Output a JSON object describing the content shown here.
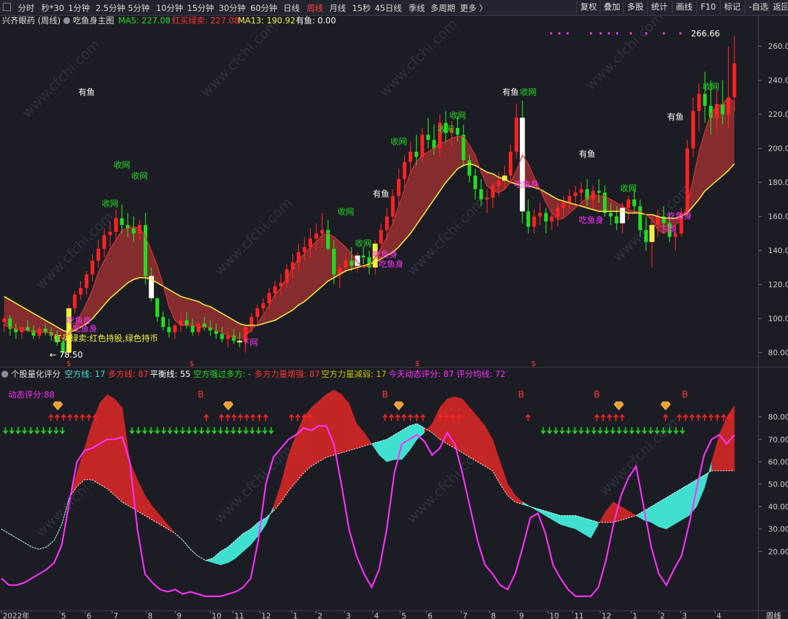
{
  "toolbar": {
    "left_items": [
      "分时",
      "秒*30",
      "1分钟",
      "2.5分钟",
      "5分钟",
      "10分钟",
      "15分钟",
      "30分钟",
      "60分钟",
      "日线",
      "周线",
      "月线",
      "15秒",
      "45日线",
      "季线",
      "多周期",
      "更多 〉"
    ],
    "active": "周线",
    "right_items": [
      "复权",
      "叠加",
      "多股",
      "统计",
      "画线",
      "F10",
      "标记",
      "-自选",
      "返回"
    ]
  },
  "colors": {
    "bg": "#1c1d24",
    "up": "#ff2222",
    "down": "#22dd22",
    "ma_yellow": "#f0f040",
    "magenta": "#ff30ff",
    "cyan": "#40e0d0",
    "band_red": "#a83232",
    "white": "#ffffff"
  },
  "main_header": {
    "stock": "兴齐眼药 (周线)",
    "indicator": "吃鱼身主图",
    "items": [
      {
        "label": "MA5: 227.08",
        "color": "#22dd22"
      },
      {
        "label": "红买绿卖: 227.08",
        "color": "#ff3333"
      },
      {
        "label": "MA13: 190.92",
        "color": "#f0f040"
      },
      {
        "label": "有鱼: 0.00",
        "color": "#ffffff"
      }
    ]
  },
  "sub_header": {
    "title": "个股量化评分",
    "items": [
      {
        "label": "空方线: 17",
        "color": "#40e0d0"
      },
      {
        "label": "多方线: 87",
        "color": "#ff3333"
      },
      {
        "label": "平衡线: 55",
        "color": "#ffffff"
      },
      {
        "label": "空方强过多方: -",
        "color": "#22dd22"
      },
      {
        "label": "多方力量增强: 87",
        "color": "#ff3333"
      },
      {
        "label": "空方力量减弱: 17",
        "color": "#c0c000"
      },
      {
        "label": "今天动态评分: 87",
        "color": "#ff30ff"
      },
      {
        "label": "评分均线: 72",
        "color": "#ff30ff"
      }
    ],
    "dynamic_label": "动态评分:88"
  },
  "annotations": {
    "high_price": "266.66",
    "low_price": "78.50",
    "low_arrow": "←",
    "text_you_yu": "有鱼",
    "text_shou_wang": "收网",
    "text_xia_wang": "下网",
    "text_chi_yu_shen": "吃鱼身",
    "text_hold": "红买绿卖:红色持股,绿色持币",
    "text_dollar": "$",
    "text_b": "B",
    "watermark": "www.cfchi.com"
  },
  "x_axis": {
    "labels": [
      "2022年",
      "5",
      "6",
      "7",
      "8",
      "9",
      "10",
      "11",
      "12",
      "1",
      "2",
      "3",
      "4",
      "5",
      "6",
      "7",
      "8",
      "9",
      "10",
      "11",
      "12",
      "1",
      "2",
      "3",
      "4"
    ],
    "corner": "周线"
  },
  "chart_data": [
    {
      "type": "candlestick",
      "title": "吃鱼身主图",
      "y_ticks": [
        80,
        100,
        120,
        140,
        160,
        180,
        200,
        220,
        240,
        260
      ],
      "ylim": [
        73,
        271
      ],
      "ohlc": [
        [
          98,
          101,
          92,
          100
        ],
        [
          100,
          102,
          90,
          94
        ],
        [
          94,
          97,
          88,
          92
        ],
        [
          92,
          95,
          88,
          95
        ],
        [
          95,
          99,
          92,
          93
        ],
        [
          93,
          96,
          88,
          90
        ],
        [
          90,
          95,
          88,
          94
        ],
        [
          94,
          97,
          90,
          92
        ],
        [
          92,
          95,
          87,
          90
        ],
        [
          90,
          93,
          84,
          86
        ],
        [
          86,
          89,
          79,
          80
        ],
        [
          80,
          108,
          78,
          106
        ],
        [
          106,
          116,
          103,
          114
        ],
        [
          114,
          122,
          111,
          118
        ],
        [
          118,
          128,
          114,
          126
        ],
        [
          126,
          138,
          122,
          134
        ],
        [
          134,
          146,
          130,
          141
        ],
        [
          141,
          153,
          136,
          149
        ],
        [
          149,
          157,
          142,
          151
        ],
        [
          151,
          164,
          145,
          159
        ],
        [
          159,
          167,
          150,
          155
        ],
        [
          155,
          162,
          148,
          153
        ],
        [
          153,
          160,
          145,
          150
        ],
        [
          150,
          158,
          146,
          155
        ],
        [
          155,
          162,
          120,
          125
        ],
        [
          125,
          130,
          110,
          112
        ],
        [
          112,
          108,
          98,
          101
        ],
        [
          101,
          104,
          93,
          95
        ],
        [
          95,
          100,
          89,
          92
        ],
        [
          92,
          97,
          88,
          96
        ],
        [
          96,
          102,
          92,
          99
        ],
        [
          99,
          104,
          94,
          96
        ],
        [
          96,
          100,
          90,
          92
        ],
        [
          92,
          98,
          90,
          97
        ],
        [
          97,
          101,
          93,
          95
        ],
        [
          95,
          99,
          90,
          93
        ],
        [
          93,
          97,
          88,
          91
        ],
        [
          91,
          95,
          86,
          88
        ],
        [
          88,
          93,
          83,
          90
        ],
        [
          90,
          94,
          85,
          87
        ],
        [
          87,
          92,
          83,
          86
        ],
        [
          86,
          96,
          80,
          95
        ],
        [
          95,
          103,
          92,
          101
        ],
        [
          101,
          108,
          98,
          106
        ],
        [
          106,
          112,
          103,
          109
        ],
        [
          109,
          118,
          106,
          115
        ],
        [
          115,
          122,
          112,
          119
        ],
        [
          119,
          126,
          114,
          121
        ],
        [
          121,
          132,
          118,
          129
        ],
        [
          129,
          138,
          124,
          133
        ],
        [
          133,
          144,
          128,
          139
        ],
        [
          139,
          148,
          134,
          142
        ],
        [
          142,
          153,
          136,
          147
        ],
        [
          147,
          156,
          140,
          150
        ],
        [
          150,
          162,
          142,
          152
        ],
        [
          152,
          158,
          140,
          141
        ],
        [
          141,
          146,
          120,
          126
        ],
        [
          126,
          132,
          118,
          130
        ],
        [
          130,
          138,
          127,
          134
        ],
        [
          134,
          142,
          128,
          131
        ],
        [
          131,
          139,
          127,
          137
        ],
        [
          137,
          142,
          132,
          136
        ],
        [
          136,
          140,
          126,
          130
        ],
        [
          130,
          146,
          126,
          144
        ],
        [
          144,
          156,
          140,
          152
        ],
        [
          152,
          165,
          146,
          160
        ],
        [
          160,
          176,
          155,
          172
        ],
        [
          172,
          188,
          166,
          182
        ],
        [
          182,
          196,
          176,
          192
        ],
        [
          192,
          204,
          186,
          198
        ],
        [
          198,
          208,
          190,
          195
        ],
        [
          195,
          212,
          192,
          208
        ],
        [
          208,
          218,
          200,
          205
        ],
        [
          205,
          214,
          196,
          200
        ],
        [
          200,
          220,
          195,
          215
        ],
        [
          215,
          222,
          203,
          209
        ],
        [
          209,
          216,
          201,
          212
        ],
        [
          212,
          219,
          204,
          208
        ],
        [
          208,
          214,
          189,
          193
        ],
        [
          193,
          196,
          180,
          184
        ],
        [
          184,
          188,
          170,
          176
        ],
        [
          176,
          182,
          166,
          170
        ],
        [
          170,
          176,
          162,
          171
        ],
        [
          171,
          180,
          165,
          178
        ],
        [
          178,
          186,
          172,
          181
        ],
        [
          181,
          190,
          176,
          184
        ],
        [
          184,
          202,
          180,
          198
        ],
        [
          198,
          226,
          194,
          218
        ],
        [
          218,
          228,
          156,
          163
        ],
        [
          163,
          170,
          150,
          154
        ],
        [
          154,
          164,
          150,
          160
        ],
        [
          160,
          168,
          155,
          162
        ],
        [
          162,
          165,
          150,
          157
        ],
        [
          157,
          164,
          152,
          160
        ],
        [
          160,
          168,
          154,
          165
        ],
        [
          165,
          172,
          160,
          168
        ],
        [
          168,
          176,
          164,
          172
        ],
        [
          172,
          178,
          166,
          174
        ],
        [
          174,
          180,
          168,
          176
        ],
        [
          176,
          182,
          166,
          170
        ],
        [
          170,
          178,
          164,
          175
        ],
        [
          175,
          182,
          168,
          174
        ],
        [
          174,
          178,
          160,
          162
        ],
        [
          162,
          168,
          155,
          160
        ],
        [
          160,
          166,
          152,
          156
        ],
        [
          156,
          168,
          150,
          165
        ],
        [
          165,
          172,
          158,
          170
        ],
        [
          170,
          176,
          162,
          166
        ],
        [
          166,
          170,
          148,
          152
        ],
        [
          152,
          160,
          140,
          145
        ],
        [
          145,
          160,
          130,
          155
        ],
        [
          155,
          164,
          148,
          160
        ],
        [
          160,
          166,
          152,
          156
        ],
        [
          156,
          162,
          145,
          148
        ],
        [
          148,
          155,
          140,
          150
        ],
        [
          150,
          165,
          148,
          162
        ],
        [
          162,
          205,
          160,
          200
        ],
        [
          200,
          230,
          195,
          222
        ],
        [
          222,
          238,
          210,
          232
        ],
        [
          232,
          245,
          215,
          225
        ],
        [
          225,
          240,
          208,
          218
        ],
        [
          218,
          234,
          210,
          226
        ],
        [
          226,
          240,
          214,
          220
        ],
        [
          220,
          260,
          212,
          230
        ],
        [
          230,
          266,
          222,
          250
        ]
      ],
      "ma5": [
        96,
        95,
        94,
        93,
        93,
        92,
        92,
        92,
        91,
        90,
        88,
        91,
        96,
        102,
        109,
        117,
        127,
        134,
        141,
        146,
        152,
        153,
        154,
        153,
        148,
        140,
        131,
        120,
        107,
        99,
        96,
        96,
        96,
        95,
        95,
        95,
        93,
        92,
        90,
        89,
        88,
        90,
        93,
        97,
        102,
        108,
        114,
        118,
        124,
        130,
        135,
        138,
        142,
        145,
        149,
        150,
        148,
        145,
        142,
        138,
        133,
        130,
        131,
        136,
        141,
        148,
        156,
        166,
        176,
        186,
        192,
        196,
        198,
        200,
        203,
        204,
        206,
        207,
        207,
        202,
        196,
        186,
        178,
        175,
        174,
        176,
        180,
        187,
        196,
        191,
        183,
        176,
        168,
        162,
        158,
        159,
        162,
        165,
        168,
        171,
        173,
        172,
        172,
        170,
        168,
        166,
        164,
        163,
        163,
        161,
        158,
        152,
        150,
        152,
        155,
        158,
        166,
        182,
        198,
        210,
        220,
        225,
        226,
        230,
        227
      ],
      "ma13": [
        113,
        111,
        109,
        107,
        105,
        103,
        101,
        99,
        97,
        95,
        93,
        92,
        93,
        95,
        97,
        100,
        104,
        108,
        112,
        115,
        118,
        121,
        123,
        124,
        124,
        123,
        121,
        119,
        117,
        115,
        113,
        112,
        111,
        110,
        108,
        107,
        105,
        103,
        101,
        99,
        97,
        96,
        96,
        96,
        97,
        98,
        99,
        101,
        103,
        105,
        108,
        110,
        113,
        116,
        119,
        122,
        124,
        126,
        128,
        129,
        130,
        131,
        132,
        133,
        135,
        137,
        139,
        142,
        146,
        150,
        155,
        160,
        165,
        170,
        175,
        180,
        184,
        188,
        190,
        191,
        190,
        188,
        186,
        185,
        183,
        182,
        180,
        179,
        178,
        178,
        177,
        176,
        174,
        172,
        170,
        169,
        168,
        167,
        166,
        165,
        164,
        163,
        163,
        163,
        163,
        163,
        162,
        162,
        162,
        161,
        161,
        160,
        159,
        159,
        159,
        160,
        162,
        166,
        170,
        175,
        178,
        181,
        184,
        187,
        191
      ]
    },
    {
      "type": "area+line",
      "title": "个股量化评分",
      "y_ticks": [
        20,
        30,
        40,
        50,
        60,
        70,
        80
      ],
      "ylim": [
        -4,
        96
      ],
      "score": [
        8,
        5,
        5,
        6,
        8,
        10,
        12,
        15,
        23,
        42,
        60,
        65,
        66,
        68,
        70,
        70,
        71,
        60,
        30,
        10,
        6,
        3,
        2,
        3,
        1,
        2,
        1,
        0,
        0,
        0,
        1,
        2,
        4,
        8,
        25,
        50,
        62,
        66,
        70,
        72,
        75,
        74,
        76,
        76,
        68,
        50,
        30,
        18,
        10,
        4,
        12,
        30,
        55,
        68,
        70,
        72,
        69,
        63,
        66,
        73,
        68,
        55,
        40,
        25,
        14,
        10,
        5,
        3,
        10,
        22,
        35,
        37,
        28,
        14,
        8,
        3,
        0,
        0,
        0,
        4,
        16,
        32,
        45,
        53,
        58,
        40,
        22,
        10,
        5,
        12,
        18,
        32,
        48,
        63,
        70,
        72,
        68,
        72
      ],
      "upper": [
        30,
        28,
        26,
        24,
        22,
        21,
        22,
        25,
        32,
        44,
        55,
        66,
        77,
        86,
        90,
        88,
        84,
        60,
        52,
        45,
        40,
        36,
        32,
        28,
        25,
        21,
        18,
        16,
        15,
        14,
        15,
        17,
        20,
        23,
        27,
        32,
        40,
        50,
        63,
        72,
        80,
        84,
        87,
        90,
        92,
        90,
        86,
        77,
        73,
        68,
        63,
        60,
        61,
        61,
        65,
        70,
        73,
        77,
        84,
        88,
        89,
        88,
        84,
        80,
        76,
        70,
        60,
        50,
        45,
        42,
        40,
        38,
        36,
        34,
        32,
        31,
        30,
        28,
        26,
        32,
        38,
        42,
        40,
        38,
        36,
        34,
        33,
        31,
        30,
        32,
        34,
        36,
        40,
        48,
        60,
        72,
        80,
        85,
        88
      ],
      "lower": [
        30,
        28,
        26,
        24,
        22,
        21,
        22,
        25,
        32,
        44,
        49,
        52,
        52,
        50,
        48,
        45,
        42,
        40,
        38,
        36,
        34,
        32,
        30,
        28,
        25,
        21,
        18,
        16,
        17,
        20,
        22,
        25,
        28,
        30,
        33,
        35,
        38,
        42,
        47,
        51,
        55,
        58,
        60,
        62,
        63,
        64,
        65,
        66,
        67,
        68,
        69,
        70,
        72,
        74,
        76,
        77,
        75,
        73,
        70,
        68,
        66,
        64,
        62,
        60,
        58,
        56,
        50,
        45,
        42,
        41,
        40,
        39,
        38,
        37,
        36,
        36,
        36,
        35,
        34,
        33,
        33,
        33,
        34,
        35,
        36,
        38,
        40,
        42,
        44,
        46,
        48,
        50,
        52,
        54,
        56
      ]
    }
  ]
}
